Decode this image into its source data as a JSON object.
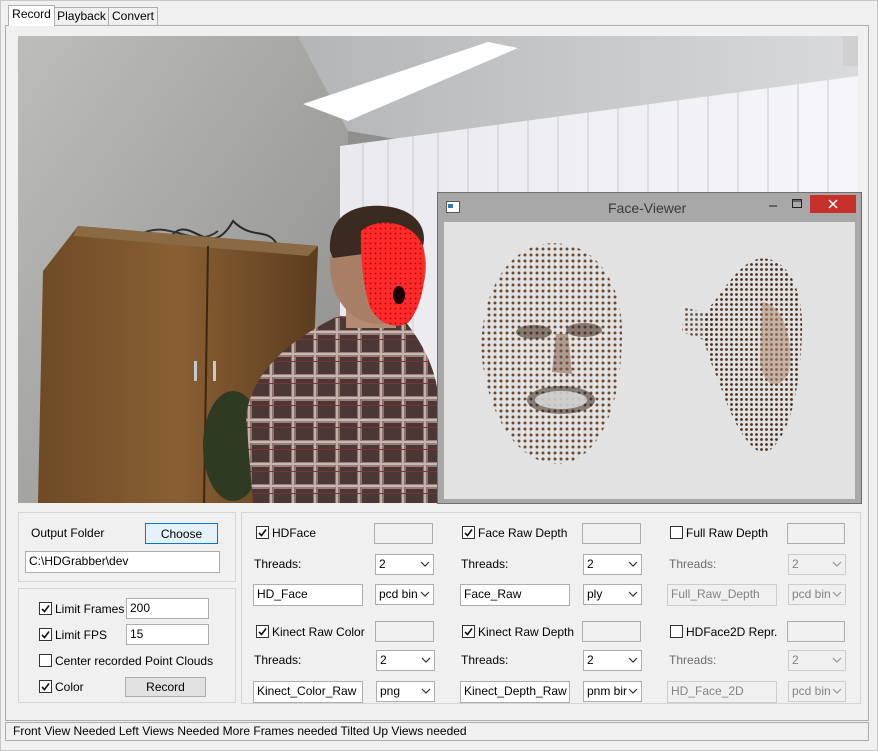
{
  "tabs": [
    "Record",
    "Playback",
    "Convert"
  ],
  "face_viewer": {
    "title": "Face-Viewer"
  },
  "output": {
    "folder_label": "Output Folder",
    "choose_label": "Choose",
    "path": "C:\\HDGrabber\\dev"
  },
  "options": {
    "limit_frames": {
      "label": "Limit Frames",
      "checked": true,
      "value": "200"
    },
    "limit_fps": {
      "label": "Limit FPS",
      "checked": true,
      "value": "15"
    },
    "center_clouds": {
      "label": "Center recorded Point Clouds",
      "checked": false
    },
    "color": {
      "label": "Color",
      "checked": true
    },
    "record_label": "Record"
  },
  "streams": [
    {
      "label": "HDFace",
      "checked": true,
      "threads_label": "Threads:",
      "threads": "2",
      "filename": "HD_Face",
      "format": "pcd bin",
      "enabled": true
    },
    {
      "label": "Face Raw Depth",
      "checked": true,
      "threads_label": "Threads:",
      "threads": "2",
      "filename": "Face_Raw",
      "format": "ply",
      "enabled": true
    },
    {
      "label": "Full Raw Depth",
      "checked": false,
      "threads_label": "Threads:",
      "threads": "2",
      "filename": "Full_Raw_Depth",
      "format": "pcd bin",
      "enabled": false
    },
    {
      "label": "Kinect Raw Color",
      "checked": true,
      "threads_label": "Threads:",
      "threads": "2",
      "filename": "Kinect_Color_Raw",
      "format": "png",
      "enabled": true
    },
    {
      "label": "Kinect Raw Depth",
      "checked": true,
      "threads_label": "Threads:",
      "threads": "2",
      "filename": "Kinect_Depth_Raw",
      "format": "pnm bir",
      "enabled": true
    },
    {
      "label": "HDFace2D Repr.",
      "checked": false,
      "threads_label": "Threads:",
      "threads": "2",
      "filename": "HD_Face_2D",
      "format": "pcd bin",
      "enabled": false
    }
  ],
  "status": "Front View Needed Left Views Needed More Frames needed Tilted Up Views needed",
  "colors": {
    "accent": "#0078d7",
    "close_button": "#c7302b",
    "mesh_overlay": "#ff1f1f"
  }
}
